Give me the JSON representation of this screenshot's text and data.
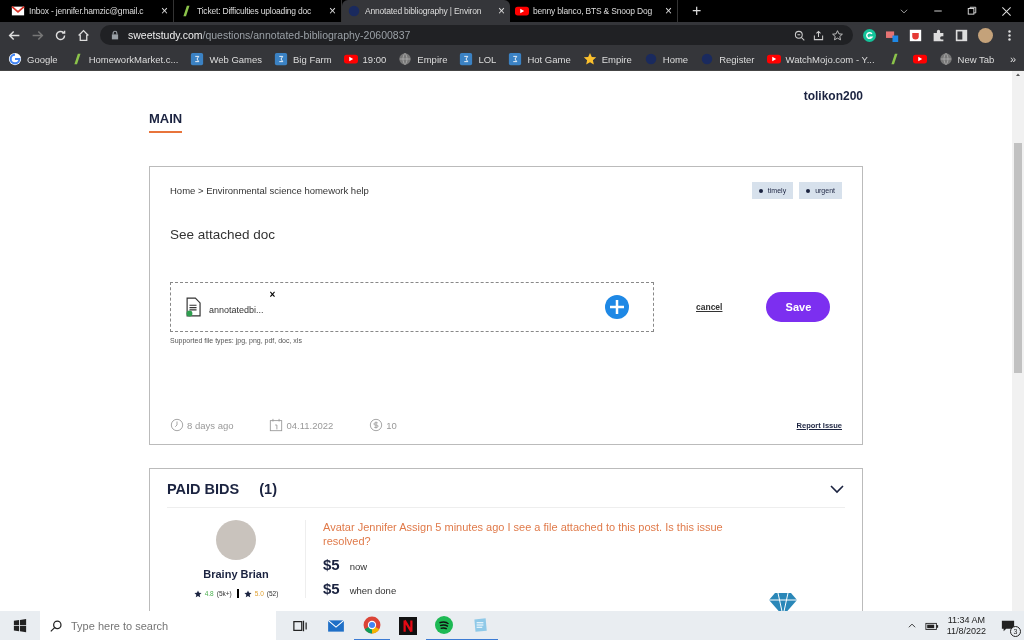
{
  "browser": {
    "tabs": [
      {
        "title": "Inbox - jennifer.hamzic@gmail.c",
        "kind": "mail",
        "selected": false,
        "close": "×"
      },
      {
        "title": "Ticket: Difficulties uploading doc",
        "kind": "leaf",
        "selected": false,
        "close": "×"
      },
      {
        "title": "Annotated bibliography | Environ",
        "kind": "circle",
        "selected": true,
        "close": "×"
      },
      {
        "title": "benny blanco, BTS & Snoop Dog",
        "kind": "play",
        "selected": false,
        "close": "×"
      }
    ],
    "new_tab": "+",
    "url": {
      "host": "sweetstudy.com",
      "path": "/questions/annotated-bibliography-20600837"
    },
    "bookmarks": [
      {
        "label": "Google",
        "kind": "google"
      },
      {
        "label": "HomeworkMarket.c...",
        "kind": "leaf"
      },
      {
        "label": "Web Games",
        "kind": "square"
      },
      {
        "label": "Big Farm",
        "kind": "square"
      },
      {
        "label": "19:00",
        "kind": "play"
      },
      {
        "label": "Empire",
        "kind": "globe"
      },
      {
        "label": "LOL",
        "kind": "square"
      },
      {
        "label": "Hot Game",
        "kind": "square"
      },
      {
        "label": "Empire",
        "kind": "star"
      },
      {
        "label": "Home",
        "kind": "circle"
      },
      {
        "label": "Register",
        "kind": "circle"
      },
      {
        "label": "WatchMojo.com - Y...",
        "kind": "play"
      },
      {
        "kind": "leaf"
      },
      {
        "kind": "play"
      },
      {
        "label": "New Tab",
        "kind": "globe"
      }
    ],
    "more_bookmarks": "»"
  },
  "page": {
    "username": "tolikon200",
    "section_title": "MAIN",
    "question": {
      "breadcrumb": "Home > Environmental science homework help",
      "tags": [
        "timely",
        "urgent"
      ],
      "body": "See attached doc",
      "attachment": {
        "filename": "annotatedbi...",
        "remove": "×"
      },
      "hint": "Supported file types: jpg, png, pdf, doc, xls",
      "cancel": "cancel",
      "save": "Save",
      "meta": [
        {
          "kind": "clock",
          "text": "8 days ago"
        },
        {
          "kind": "calendar",
          "text": "04.11.2022"
        },
        {
          "kind": "coin",
          "text": "10"
        }
      ],
      "report": "Report Issue"
    },
    "bids": {
      "title": "PAID BIDS",
      "count": "(1)",
      "expanded": true,
      "bid": {
        "name": "Brainy Brian",
        "rating_1": "4.8",
        "count_1": "(5k+)",
        "rating_2": "5.0",
        "count_2": "(52)",
        "comment": "Avatar Jennifer Assign 5 minutes ago I see a file attached to this post. Is this issue resolved?",
        "prices": [
          {
            "amount": "$5",
            "label": "now"
          },
          {
            "amount": "$5",
            "label": "when done"
          }
        ]
      }
    }
  },
  "taskbar": {
    "search": {
      "placeholder": "Type here to search"
    },
    "time": "11:34 AM",
    "date": "11/8/2022",
    "notifications": "3"
  }
}
